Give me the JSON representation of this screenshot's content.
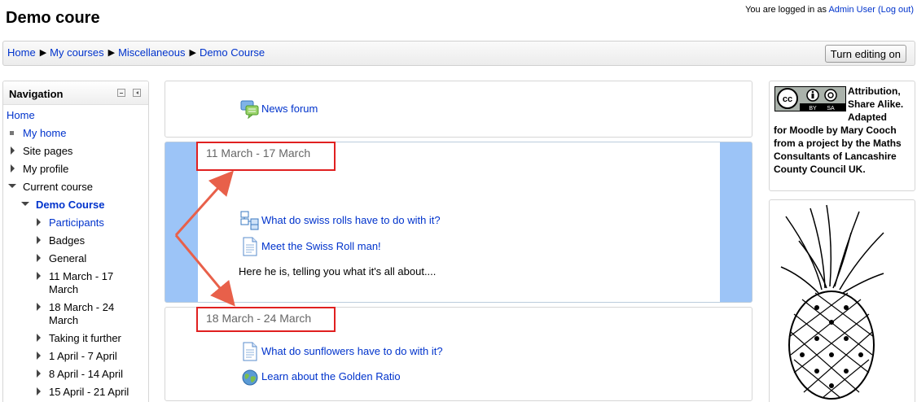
{
  "header": {
    "title": "Demo coure",
    "login_prefix": "You are logged in as",
    "user_name": "Admin User",
    "logout": "(Log out)"
  },
  "breadcrumb": {
    "items": [
      "Home",
      "My courses",
      "Miscellaneous",
      "Demo Course"
    ],
    "separator": "▶"
  },
  "toolbar": {
    "edit_label": "Turn editing on"
  },
  "navigation": {
    "title": "Navigation",
    "home": "Home",
    "my_home": "My home",
    "site_pages": "Site pages",
    "my_profile": "My profile",
    "current_course": "Current course",
    "course": "Demo Course",
    "participants": "Participants",
    "badges": "Badges",
    "general": "General",
    "week1_a": "11 March - 17",
    "week1_b": "March",
    "week2_a": "18 March - 24",
    "week2_b": "March",
    "taking_further": "Taking it further",
    "april1": "1 April - 7 April",
    "april2": "8 April - 14 April",
    "april3": "15 April - 21 April"
  },
  "sections": {
    "general": {
      "news": "News forum"
    },
    "week1": {
      "title": "11 March - 17 March",
      "activity1": "What do swiss rolls have to do with it?",
      "activity2": "Meet the Swiss Roll man!",
      "text": "Here he is, telling you what it's all about...."
    },
    "week2": {
      "title": "18 March - 24 March",
      "activity1": "What do sunflowers have to do with it?",
      "activity2": "Learn about the Golden Ratio"
    }
  },
  "license": {
    "line1": "Attribution,",
    "line2": "Share Alike.",
    "line3": "Adapted",
    "line4": "for Moodle by Mary Cooch",
    "line5": "from a project by the Maths",
    "line6": "Consultants of Lancashire",
    "line7": "County Council UK.",
    "badge_by": "BY",
    "badge_sa": "SA"
  },
  "colors": {
    "link": "#0033cc",
    "current_week_highlight": "#9cc4f7",
    "annotation": "#e02020"
  }
}
